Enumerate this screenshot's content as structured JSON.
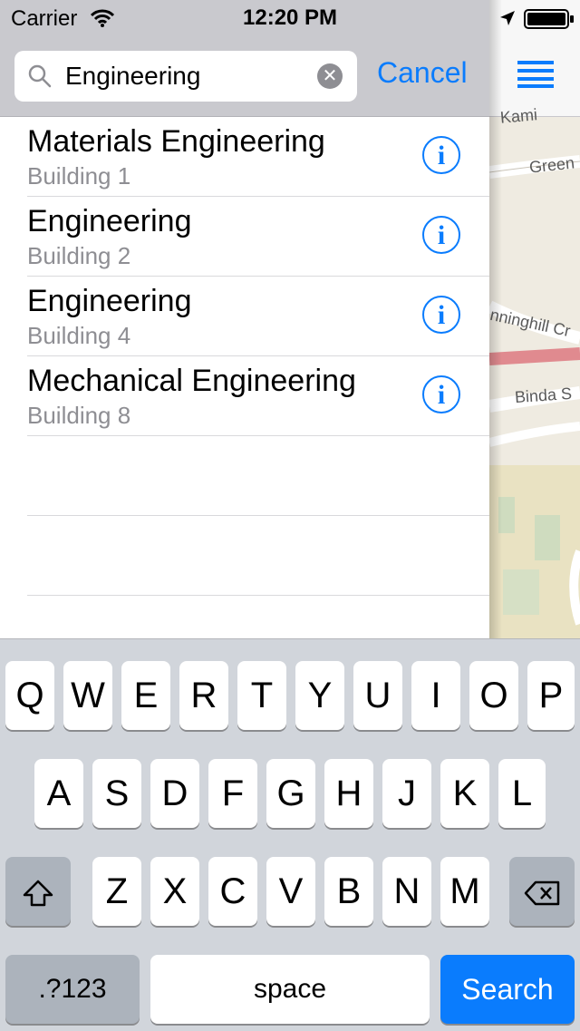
{
  "status_bar": {
    "carrier": "Carrier",
    "time": "12:20 PM"
  },
  "search": {
    "query": "Engineering",
    "cancel_label": "Cancel"
  },
  "results": [
    {
      "title": "Materials Engineering",
      "subtitle": "Building 1"
    },
    {
      "title": "Engineering",
      "subtitle": "Building 2"
    },
    {
      "title": "Engineering",
      "subtitle": "Building 4"
    },
    {
      "title": "Mechanical Engineering",
      "subtitle": "Building 8"
    }
  ],
  "map": {
    "labels": [
      "Kami",
      "Green",
      "nninghill Cr",
      "Binda S"
    ]
  },
  "keyboard": {
    "row1": [
      "Q",
      "W",
      "E",
      "R",
      "T",
      "Y",
      "U",
      "I",
      "O",
      "P"
    ],
    "row2": [
      "A",
      "S",
      "D",
      "F",
      "G",
      "H",
      "J",
      "K",
      "L"
    ],
    "row3": [
      "Z",
      "X",
      "C",
      "V",
      "B",
      "N",
      "M"
    ],
    "numbers_label": ".?123",
    "space_label": "space",
    "search_label": "Search"
  },
  "colors": {
    "accent": "#0a7cfd",
    "bar_background": "#c9c9ce",
    "keyboard_background": "#d1d5db"
  }
}
